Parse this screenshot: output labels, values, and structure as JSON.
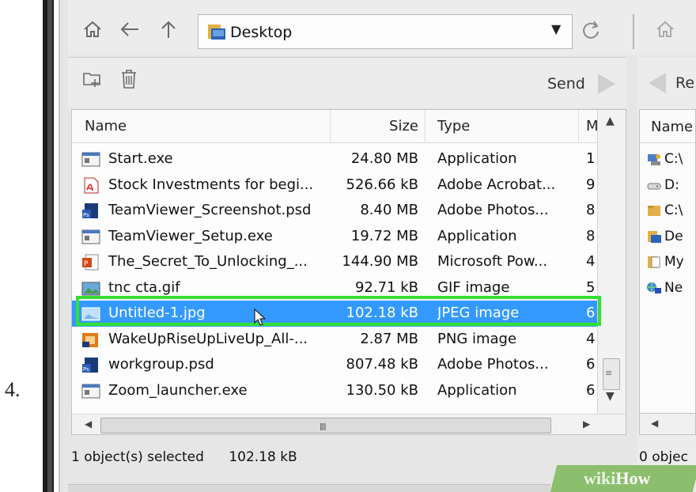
{
  "step_number": "4.",
  "address_bar": {
    "path": "Desktop",
    "nav_icons": [
      "home-icon",
      "back-arrow-icon",
      "up-arrow-icon",
      "refresh-icon"
    ]
  },
  "toolbar": {
    "icons": [
      "new-folder-icon",
      "delete-icon"
    ],
    "send_label": "Send"
  },
  "file_list": {
    "columns": [
      "Name",
      "Size",
      "Type",
      "M"
    ],
    "rows": [
      {
        "name": "Start.exe",
        "size": "24.80 MB",
        "type": "Application",
        "mod": "1",
        "icon": "exe-icon"
      },
      {
        "name": "Stock Investments for begi...",
        "size": "526.66 kB",
        "type": "Adobe Acrobat...",
        "mod": "9",
        "icon": "pdf-icon"
      },
      {
        "name": "TeamViewer_Screenshot.psd",
        "size": "8.40 MB",
        "type": "Adobe Photos...",
        "mod": "8",
        "icon": "psd-icon"
      },
      {
        "name": "TeamViewer_Setup.exe",
        "size": "19.72 MB",
        "type": "Application",
        "mod": "8",
        "icon": "exe-icon"
      },
      {
        "name": "The_Secret_To_Unlocking_...",
        "size": "144.90 MB",
        "type": "Microsoft Pow...",
        "mod": "4",
        "icon": "ppt-icon"
      },
      {
        "name": "tnc cta.gif",
        "size": "92.71 kB",
        "type": "GIF image",
        "mod": "5",
        "icon": "gif-icon"
      },
      {
        "name": "Untitled-1.jpg",
        "size": "102.18 kB",
        "type": "JPEG image",
        "mod": "6",
        "icon": "jpg-icon",
        "selected": true
      },
      {
        "name": "WakeUpRiseUpLiveUp_All-...",
        "size": "2.87 MB",
        "type": "PNG image",
        "mod": "4",
        "icon": "png-icon"
      },
      {
        "name": "workgroup.psd",
        "size": "807.48 kB",
        "type": "Adobe Photos...",
        "mod": "6",
        "icon": "psd-icon"
      },
      {
        "name": "Zoom_launcher.exe",
        "size": "130.50 kB",
        "type": "Application",
        "mod": "6",
        "icon": "exe-icon"
      }
    ],
    "hscroll_grip": "III"
  },
  "status": {
    "selected_text": "1 object(s) selected",
    "selected_size": "102.18 kB"
  },
  "right_panel": {
    "toolbar_label": "Re",
    "header": "Name",
    "items": [
      {
        "label": "C:\\",
        "icon": "computer-drive-icon"
      },
      {
        "label": "D:",
        "icon": "drive-icon"
      },
      {
        "label": "C:\\",
        "icon": "folder-icon"
      },
      {
        "label": "De",
        "icon": "desktop-folder-icon"
      },
      {
        "label": "My",
        "icon": "documents-icon"
      },
      {
        "label": "Ne",
        "icon": "network-icon"
      }
    ],
    "status": "0 objec"
  },
  "watermark": {
    "part1": "wiki",
    "part2": "How"
  },
  "colors": {
    "selection": "#3399ff",
    "highlight_outline": "#33e033",
    "watermark_bg": "#8bbf6e"
  }
}
